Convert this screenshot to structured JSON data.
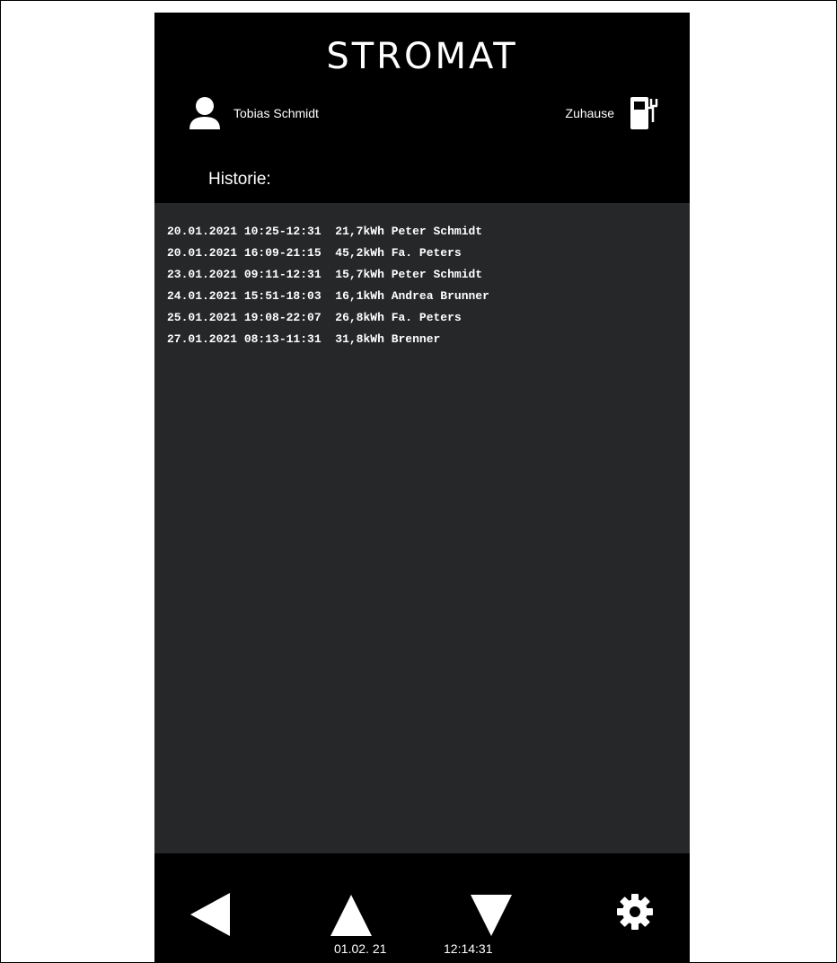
{
  "app": {
    "logo": "STROMAT"
  },
  "header": {
    "user_name": "Tobias Schmidt",
    "location": "Zuhause",
    "section_title": "Historie:"
  },
  "history": [
    {
      "date": "20.01.2021",
      "time": "10:25-12:31",
      "energy": "21,7kWh",
      "name": "Peter Schmidt"
    },
    {
      "date": "20.01.2021",
      "time": "16:09-21:15",
      "energy": "45,2kWh",
      "name": "Fa. Peters"
    },
    {
      "date": "23.01.2021",
      "time": "09:11-12:31",
      "energy": "15,7kWh",
      "name": "Peter Schmidt"
    },
    {
      "date": "24.01.2021",
      "time": "15:51-18:03",
      "energy": "16,1kWh",
      "name": "Andrea Brunner"
    },
    {
      "date": "25.01.2021",
      "time": "19:08-22:07",
      "energy": "26,8kWh",
      "name": "Fa. Peters"
    },
    {
      "date": "27.01.2021",
      "time": "08:13-11:31",
      "energy": "31,8kWh",
      "name": "Brenner"
    }
  ],
  "footer": {
    "date": "01.02. 21",
    "time": "12:14:31",
    "icons": [
      "back-arrow-icon",
      "up-arrow-icon",
      "down-arrow-icon",
      "gear-icon"
    ]
  },
  "colors": {
    "background": "#262729",
    "bar": "#000000",
    "text": "#ffffff"
  }
}
